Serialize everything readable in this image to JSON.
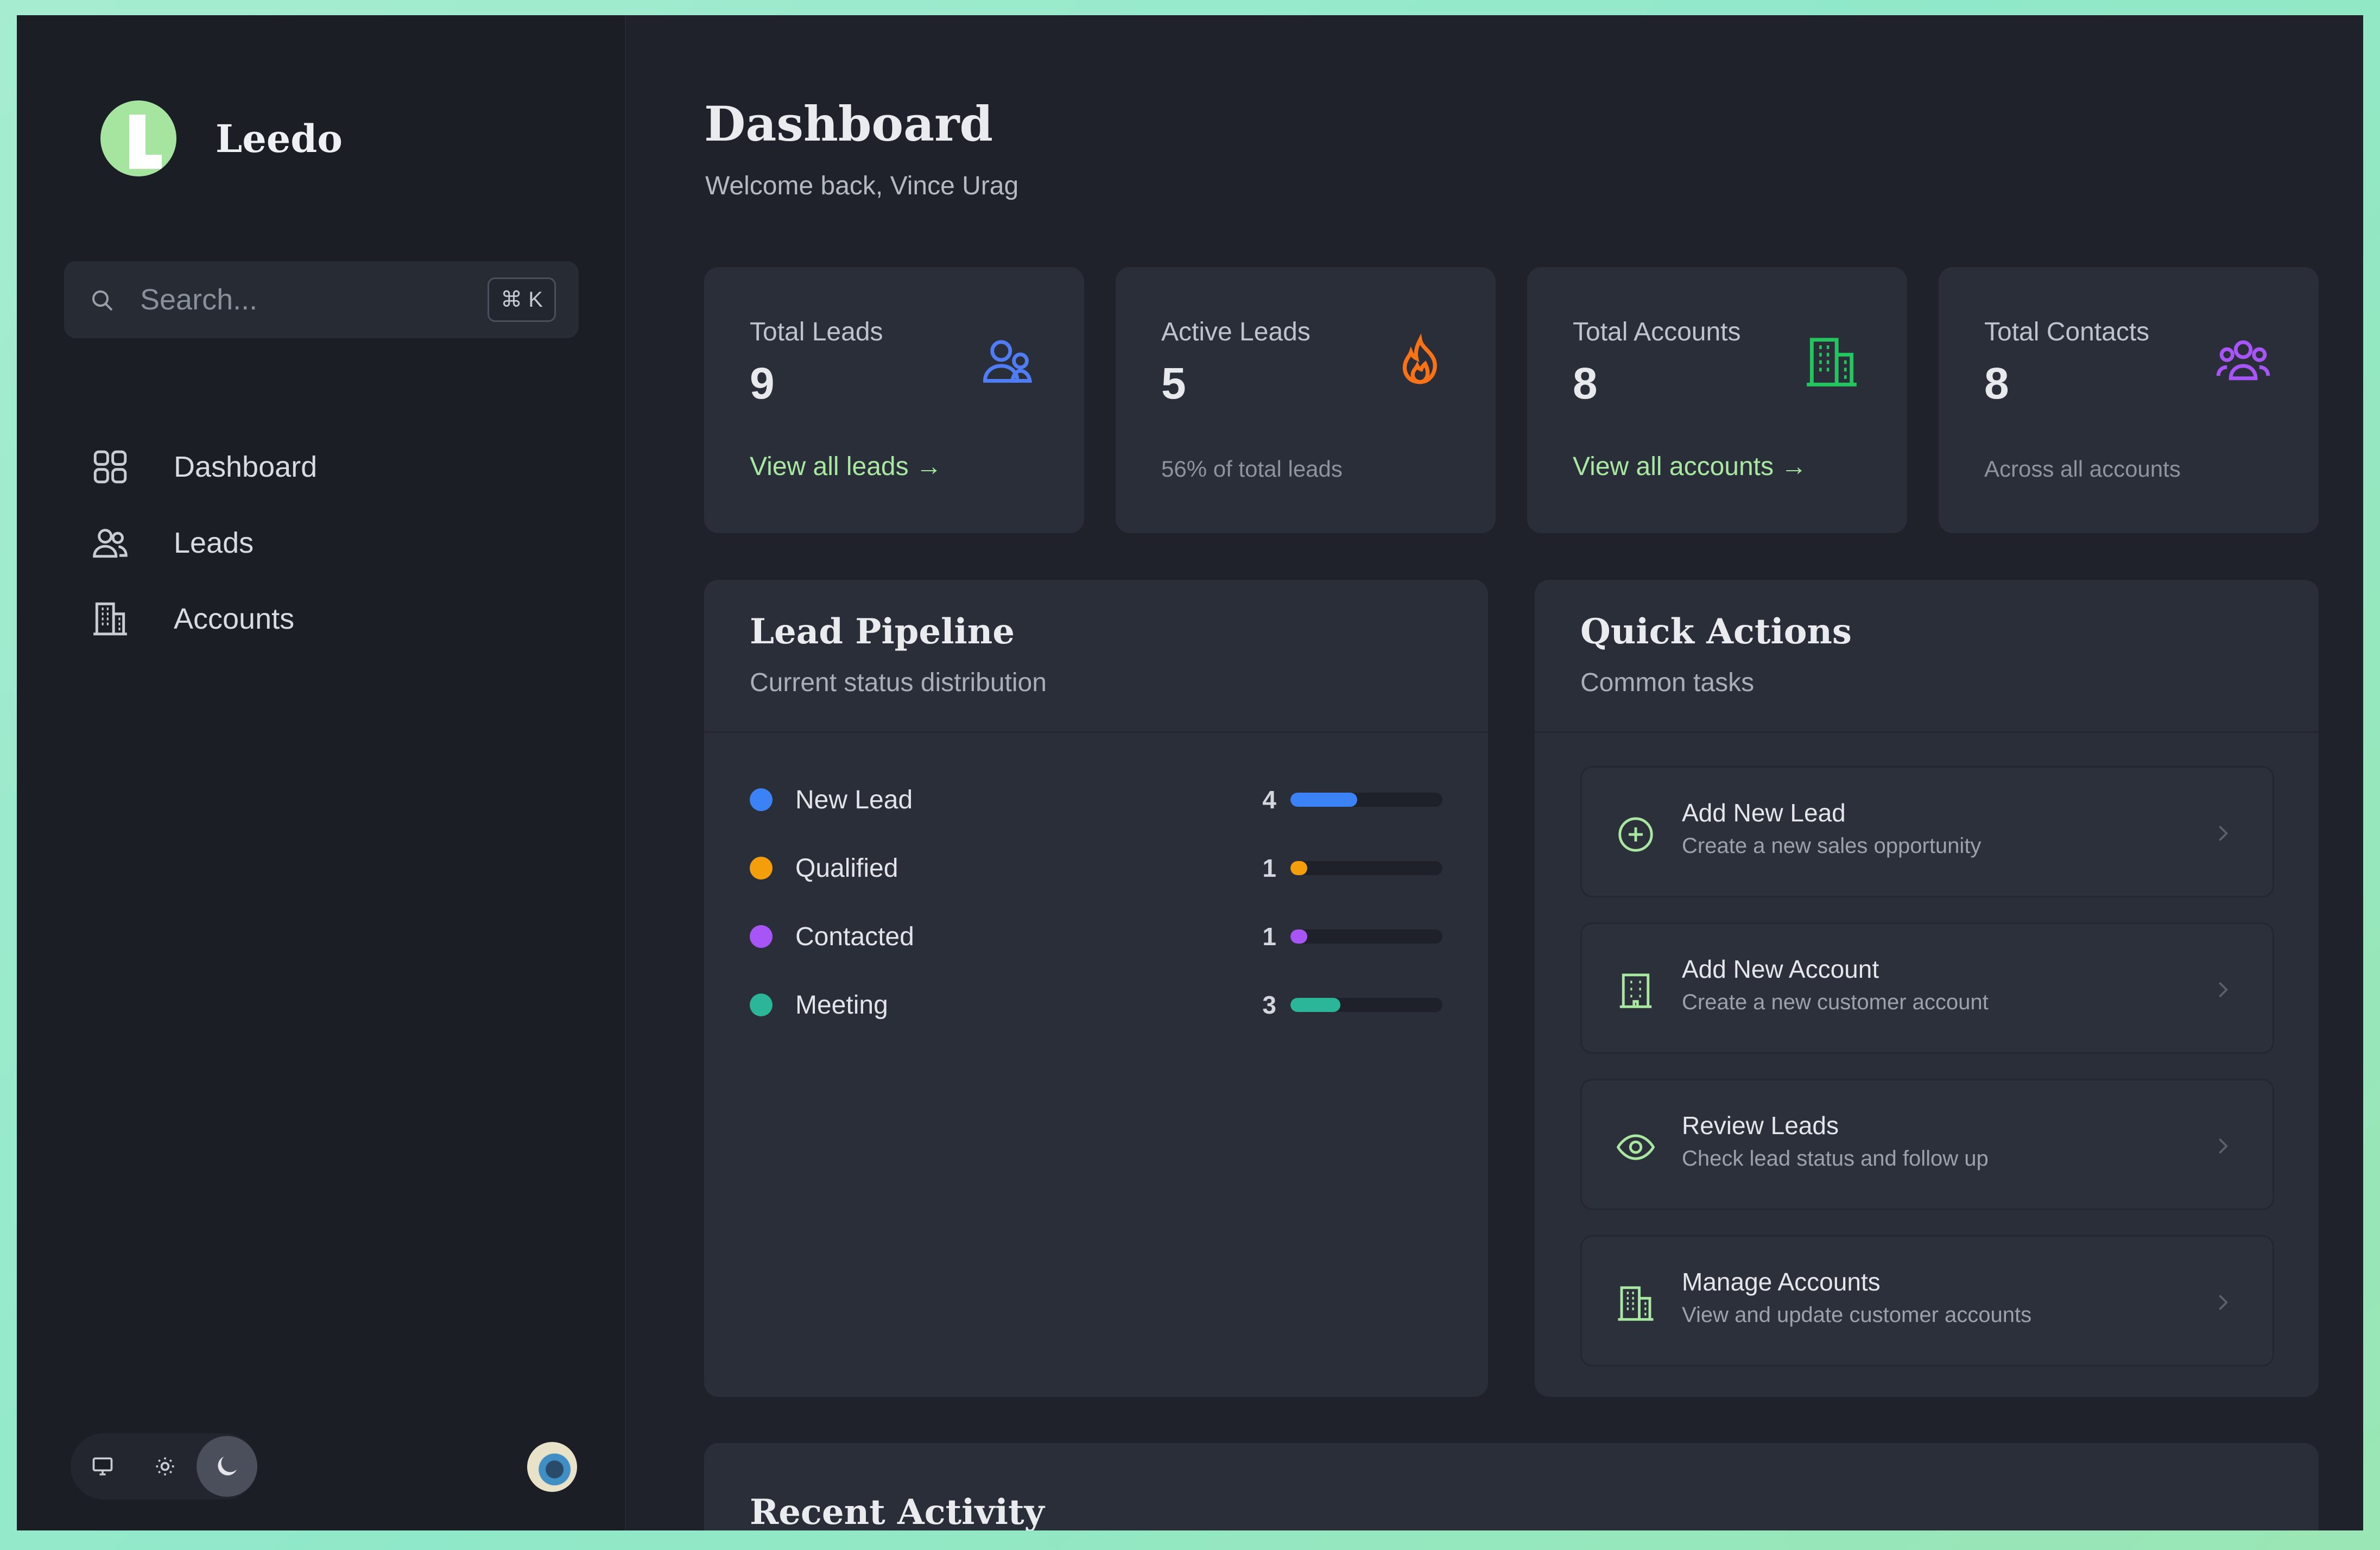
{
  "app": {
    "name": "Leedo"
  },
  "search": {
    "placeholder": "Search...",
    "shortcut": "⌘ K"
  },
  "nav": [
    {
      "label": "Dashboard",
      "icon": "grid-icon"
    },
    {
      "label": "Leads",
      "icon": "users-icon"
    },
    {
      "label": "Accounts",
      "icon": "building-icon"
    }
  ],
  "header": {
    "title": "Dashboard",
    "subtitle": "Welcome back, Vince Urag"
  },
  "stats": [
    {
      "label": "Total Leads",
      "value": "9",
      "link": "View all leads →",
      "icon": "users-icon",
      "color": "#4f7df5"
    },
    {
      "label": "Active Leads",
      "value": "5",
      "note": "56% of total leads",
      "icon": "flame-icon",
      "color": "#f97316"
    },
    {
      "label": "Total Accounts",
      "value": "8",
      "link": "View all accounts →",
      "icon": "building-icon",
      "color": "#22c55e"
    },
    {
      "label": "Total Contacts",
      "value": "8",
      "note": "Across all accounts",
      "icon": "group-icon",
      "color": "#a855f7"
    }
  ],
  "pipeline": {
    "title": "Lead Pipeline",
    "subtitle": "Current status distribution",
    "rows": [
      {
        "label": "New Lead",
        "count": "4",
        "fraction": 0.44,
        "color": "#3b82f6"
      },
      {
        "label": "Qualified",
        "count": "1",
        "fraction": 0.11,
        "color": "#f59e0b"
      },
      {
        "label": "Contacted",
        "count": "1",
        "fraction": 0.11,
        "color": "#a855f7"
      },
      {
        "label": "Meeting",
        "count": "3",
        "fraction": 0.33,
        "color": "#2bb69a"
      }
    ]
  },
  "quick_actions": {
    "title": "Quick Actions",
    "subtitle": "Common tasks",
    "items": [
      {
        "title": "Add New Lead",
        "desc": "Create a new sales opportunity",
        "icon": "plus-circle-icon"
      },
      {
        "title": "Add New Account",
        "desc": "Create a new customer account",
        "icon": "building-icon"
      },
      {
        "title": "Review Leads",
        "desc": "Check lead status and follow up",
        "icon": "eye-icon"
      },
      {
        "title": "Manage Accounts",
        "desc": "View and update customer accounts",
        "icon": "buildings-icon"
      }
    ]
  },
  "recent": {
    "title": "Recent Activity"
  },
  "accent": "#a8e8a0"
}
